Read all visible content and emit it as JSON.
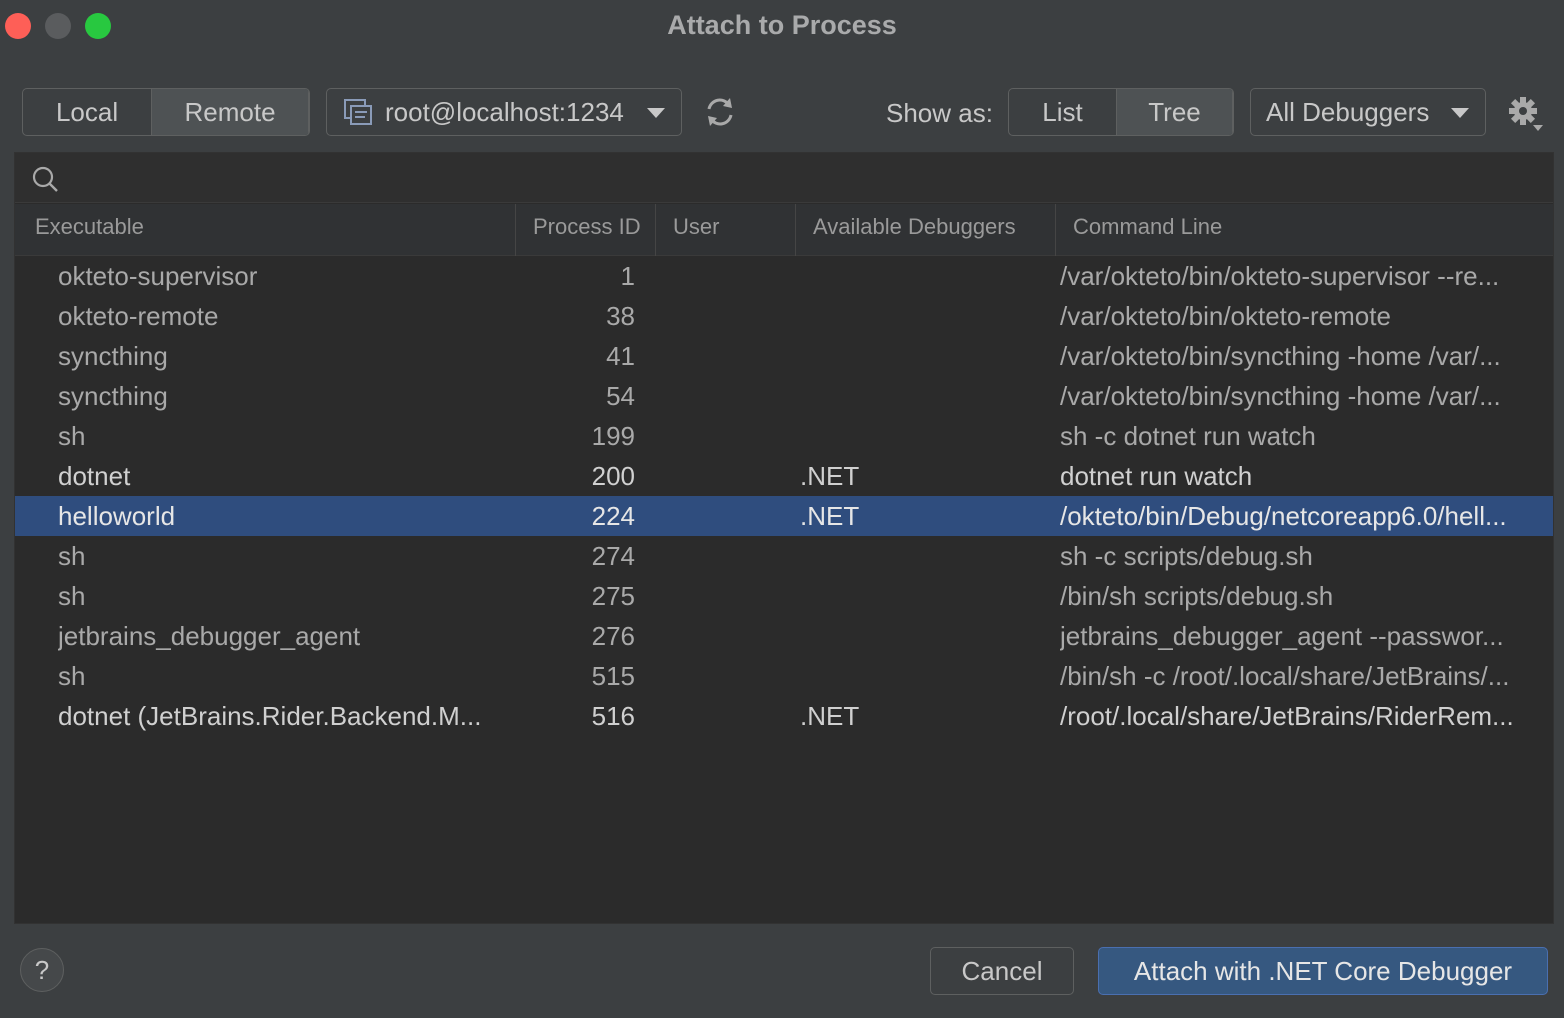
{
  "window": {
    "title": "Attach to Process"
  },
  "toolbar": {
    "mode_tabs": [
      {
        "label": "Local",
        "active": false
      },
      {
        "label": "Remote",
        "active": true
      }
    ],
    "host": {
      "value": "root@localhost:1234",
      "icon": "remote-host-icon"
    },
    "refresh_icon": "refresh-icon",
    "show_as_label": "Show as:",
    "view_tabs": [
      {
        "label": "List",
        "active": false
      },
      {
        "label": "Tree",
        "active": true
      }
    ],
    "debugger_filter": {
      "value": "All Debuggers"
    },
    "settings_icon": "gear-icon"
  },
  "search": {
    "placeholder": "",
    "icon": "search-icon"
  },
  "table": {
    "columns": [
      "Executable",
      "Process ID",
      "User",
      "Available Debuggers",
      "Command Line"
    ],
    "rows": [
      {
        "executable": "okteto-supervisor",
        "pid": "1",
        "user": "",
        "debuggers": "",
        "command": "/var/okteto/bin/okteto-supervisor --re..."
      },
      {
        "executable": "okteto-remote",
        "pid": "38",
        "user": "",
        "debuggers": "",
        "command": "/var/okteto/bin/okteto-remote"
      },
      {
        "executable": "syncthing",
        "pid": "41",
        "user": "",
        "debuggers": "",
        "command": "/var/okteto/bin/syncthing -home /var/..."
      },
      {
        "executable": "syncthing",
        "pid": "54",
        "user": "",
        "debuggers": "",
        "command": "/var/okteto/bin/syncthing -home /var/..."
      },
      {
        "executable": "sh",
        "pid": "199",
        "user": "",
        "debuggers": "",
        "command": "sh -c dotnet run watch"
      },
      {
        "executable": "dotnet",
        "pid": "200",
        "user": "",
        "debuggers": ".NET",
        "command": "dotnet run watch"
      },
      {
        "executable": "helloworld",
        "pid": "224",
        "user": "",
        "debuggers": ".NET",
        "command": "/okteto/bin/Debug/netcoreapp6.0/hell..."
      },
      {
        "executable": "sh",
        "pid": "274",
        "user": "",
        "debuggers": "",
        "command": "sh -c scripts/debug.sh"
      },
      {
        "executable": "sh",
        "pid": "275",
        "user": "",
        "debuggers": "",
        "command": "/bin/sh scripts/debug.sh"
      },
      {
        "executable": "jetbrains_debugger_agent",
        "pid": "276",
        "user": "",
        "debuggers": "",
        "command": "jetbrains_debugger_agent --passwor..."
      },
      {
        "executable": "sh",
        "pid": "515",
        "user": "",
        "debuggers": "",
        "command": "/bin/sh -c /root/.local/share/JetBrains/..."
      },
      {
        "executable": "dotnet (JetBrains.Rider.Backend.M...",
        "pid": "516",
        "user": "",
        "debuggers": ".NET",
        "command": "/root/.local/share/JetBrains/RiderRem..."
      }
    ],
    "selected_row": 6
  },
  "footer": {
    "help_label": "?",
    "cancel_label": "Cancel",
    "attach_label": "Attach with .NET Core Debugger"
  },
  "colors": {
    "background": "#3c3f41",
    "panel": "#2b2b2b",
    "selection": "#2f4d7e",
    "primary_button": "#365880",
    "close": "#fe5f57",
    "minimize": "#5a5c5e",
    "maximize": "#28c840"
  }
}
